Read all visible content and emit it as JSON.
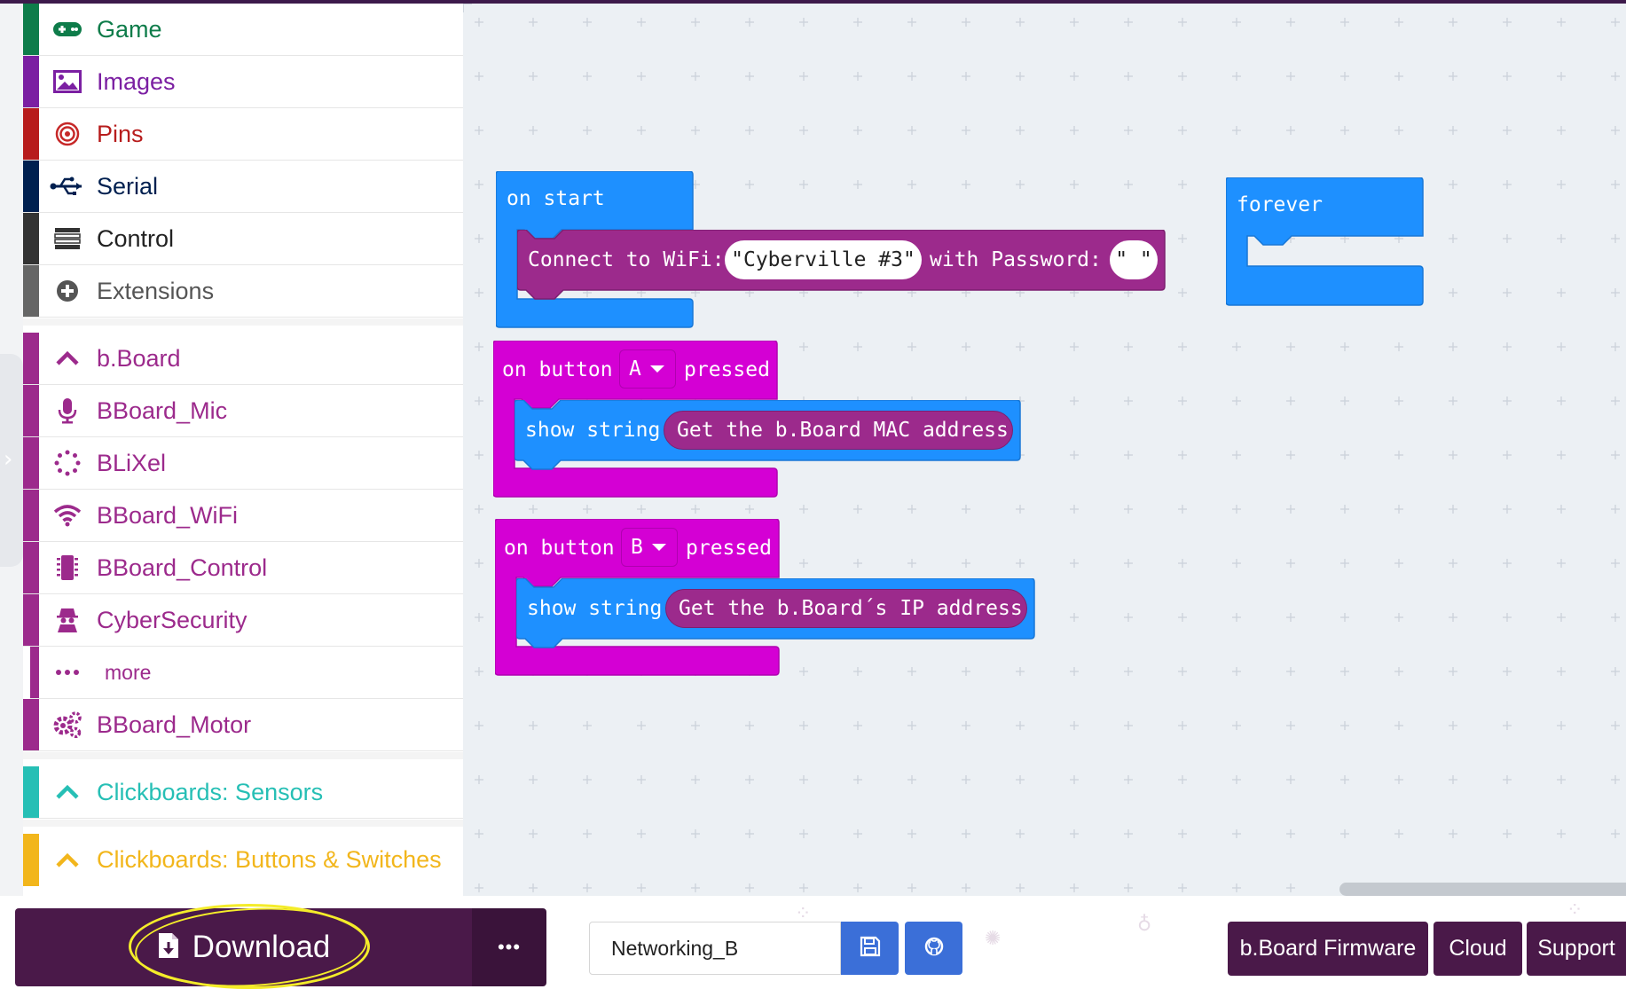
{
  "toolbox": {
    "items": [
      {
        "label": "Game",
        "color": "#0e7c4a",
        "icon": "gamepad-icon"
      },
      {
        "label": "Images",
        "color": "#7b1fa2",
        "icon": "image-icon"
      },
      {
        "label": "Pins",
        "color": "#b71c1c",
        "icon": "target-icon"
      },
      {
        "label": "Serial",
        "color": "#002050",
        "icon": "usb-icon"
      },
      {
        "label": "Control",
        "color": "#333333",
        "icon": "list-icon"
      },
      {
        "label": "Extensions",
        "color": "#666666",
        "icon": "plus-circle-icon"
      },
      {
        "label": "b.Board",
        "color": "#9c2a8c",
        "icon": "chevron-up-icon"
      },
      {
        "label": "BBoard_Mic",
        "color": "#9c2a8c",
        "icon": "microphone-icon"
      },
      {
        "label": "BLiXel",
        "color": "#9c2a8c",
        "icon": "ring-dots-icon"
      },
      {
        "label": "BBoard_WiFi",
        "color": "#9c2a8c",
        "icon": "wifi-icon"
      },
      {
        "label": "BBoard_Control",
        "color": "#9c2a8c",
        "icon": "chip-icon"
      },
      {
        "label": "CyberSecurity",
        "color": "#9c2a8c",
        "icon": "spy-icon"
      },
      {
        "label": "more",
        "color": "#9c2a8c",
        "icon": "ellipsis-icon"
      },
      {
        "label": "BBoard_Motor",
        "color": "#9c2a8c",
        "icon": "gears-icon"
      },
      {
        "label": "Clickboards: Sensors",
        "color": "#26bfb5",
        "icon": "chevron-up-icon"
      },
      {
        "label": "Clickboards: Buttons & Switches",
        "color": "#f2b61c",
        "icon": "chevron-up-icon"
      }
    ]
  },
  "blocks": {
    "on_start": {
      "label": "on start",
      "color": "#1e90ff"
    },
    "connect_wifi": {
      "label": "Connect to WiFi:",
      "ssid": "\"Cyberville #3\"",
      "with_password": "with Password:",
      "password": "\" \"",
      "color": "#9c2a8c"
    },
    "forever": {
      "label": "forever",
      "color": "#1e90ff"
    },
    "button_a": {
      "prefix": "on button",
      "button": "A",
      "suffix": "pressed",
      "color": "#d400d4"
    },
    "show_a": {
      "label": "show string",
      "value": "Get the b.Board MAC address",
      "color": "#1e90ff",
      "pill_color": "#9c2a8c"
    },
    "button_b": {
      "prefix": "on button",
      "button": "B",
      "suffix": "pressed",
      "color": "#d400d4"
    },
    "show_b": {
      "label": "show string",
      "value": "Get the b.Board´s IP address",
      "color": "#1e90ff",
      "pill_color": "#9c2a8c"
    }
  },
  "bottombar": {
    "download_label": "Download",
    "more_label": "•••",
    "project_name": "Networking_B",
    "nav": {
      "firmware": "b.Board Firmware",
      "cloud": "Cloud",
      "support": "Support"
    },
    "accent": "#4a1949",
    "button_blue": "#3b6fd8",
    "annotation_color": "#f4ec2a"
  }
}
